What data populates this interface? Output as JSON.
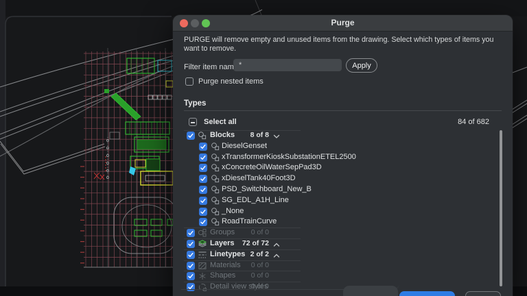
{
  "window": {
    "title": "Purge",
    "traffic_lights": [
      "close",
      "minimize-disabled",
      "zoom"
    ]
  },
  "dialog": {
    "description": "PURGE will remove empty and unused items from the drawing. Select which types of items you want to remove.",
    "filter": {
      "label": "Filter item names",
      "value": "*",
      "apply_label": "Apply"
    },
    "nested": {
      "label": "Purge nested items",
      "checked": false
    },
    "types": {
      "heading": "Types",
      "select_all_label": "Select all",
      "select_all_state": "indeterminate",
      "total_count": "84 of 682"
    },
    "tree": {
      "rows": [
        {
          "label": "Blocks",
          "count": "8 of 8",
          "icon": "block",
          "child": false,
          "check": "checked",
          "chevron": "down",
          "muted": false,
          "separator": true
        },
        {
          "label": "DieselGenset",
          "icon": "block",
          "child": true,
          "check": "checked"
        },
        {
          "label": "xTransformerKioskSubstationETEL2500",
          "icon": "block",
          "child": true,
          "check": "checked"
        },
        {
          "label": "xConcreteOilWaterSepPad3D",
          "icon": "block",
          "child": true,
          "check": "checked"
        },
        {
          "label": "xDieselTank40Foot3D",
          "icon": "block",
          "child": true,
          "check": "checked"
        },
        {
          "label": "PSD_Switchboard_New_B",
          "icon": "block",
          "child": true,
          "check": "checked"
        },
        {
          "label": "SG_EDL_A1H_Line",
          "icon": "block",
          "child": true,
          "check": "checked"
        },
        {
          "label": "_None",
          "icon": "block",
          "child": true,
          "check": "checked"
        },
        {
          "label": "RoadTrainCurve",
          "icon": "block",
          "child": true,
          "check": "checked"
        },
        {
          "label": "Groups",
          "count": "0 of 0",
          "icon": "group",
          "child": false,
          "check": "checked",
          "muted": true,
          "separator": true
        },
        {
          "label": "Layers",
          "count": "72 of 72",
          "icon": "layers",
          "child": false,
          "check": "checked",
          "chevron": "up",
          "muted": false,
          "separator": true
        },
        {
          "label": "Linetypes",
          "count": "2 of 2",
          "icon": "linetype",
          "child": false,
          "check": "checked",
          "chevron": "up",
          "muted": false,
          "separator": true
        },
        {
          "label": "Materials",
          "count": "0 of 0",
          "icon": "material",
          "child": false,
          "check": "checked",
          "muted": true,
          "separator": true
        },
        {
          "label": "Shapes",
          "count": "0 of 0",
          "icon": "shape",
          "child": false,
          "check": "checked",
          "muted": true,
          "separator": true
        },
        {
          "label": "Detail view styles",
          "count": "0 of 0",
          "icon": "detail",
          "child": false,
          "check": "checked",
          "muted": true,
          "separator": true
        }
      ]
    }
  },
  "colors": {
    "accent_blue": "#2e7de5",
    "checkbox_blue": "#3579e0",
    "traffic_close": "#ed6a5e",
    "traffic_min_disabled": "#5b5e60",
    "traffic_zoom": "#61c454",
    "cad_grid_pink": "#8c4a55",
    "cad_line_gray": "#85878a",
    "cad_green": "#33cc33",
    "cad_yellow": "#d9d932",
    "cad_cyan": "#35c8e8",
    "cad_red": "#c03333"
  }
}
